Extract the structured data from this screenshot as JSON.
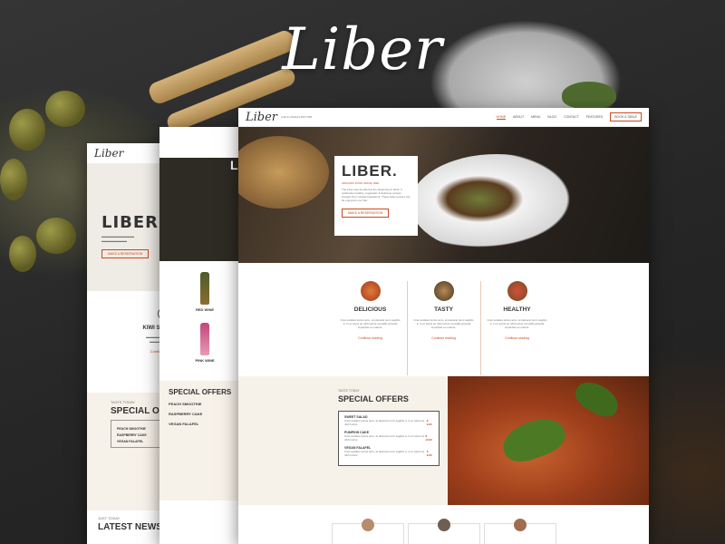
{
  "brand": {
    "logo": "Liber"
  },
  "back_screen": {
    "logo": "Liber",
    "hero_title": "LIBER.",
    "button": "MAKE A RESERVATION",
    "feature_title": "KIWI SMOOTHIE",
    "feature_link": "Continue reading",
    "offers_eyebrow": "TASTE TODAY",
    "offers_title": "SPECIAL OFFERS",
    "offers": [
      "PEACH SMOOTHIE",
      "RASPBERRY CAKE",
      "VEGAN FALAFEL"
    ],
    "news_eyebrow": "JUST TODAY",
    "news_title": "LATEST NEWS"
  },
  "mid_screen": {
    "hero_title": "LI",
    "products": [
      "RED WINE",
      "PINK WINE"
    ],
    "offers_title": "SPECIAL OFFERS",
    "offers": [
      "PEACH SMOOTHIE",
      "RASPBERRY CAKE",
      "VEGAN FALAFEL"
    ]
  },
  "front_screen": {
    "logo": "Liber",
    "contact": "Call Us (00)123 4567 890",
    "nav": [
      "HOME",
      "ABOUT",
      "MENU",
      "BLOG",
      "CONTACT",
      "FEATURES"
    ],
    "book_button": "BOOK A TABLE",
    "hero": {
      "title": "LIBER.",
      "subtitle": "ORGANIC FOOD SINCE 1996",
      "text": "The Liber was founded at the beginning of 2014. It celebrates healthy, vegetarian & delicious recipes created from natural ingredients. These tasty recipes can be enjoyed in our bar.",
      "button": "MAKE A RESERVATION"
    },
    "features": [
      {
        "title": "DELICIOUS",
        "text": "Cras sodales luctus arcu, at placerat nunc sagittis a. In et turpis ac nibh luctus convallis gravida imperdiet eu mauris.",
        "link": "Continue reading"
      },
      {
        "title": "TASTY",
        "text": "Cras sodales luctus arcu, at placerat nunc sagittis a. In et turpis ac nibh luctus convallis gravida imperdiet eu mauris.",
        "link": "Continue reading"
      },
      {
        "title": "HEALTHY",
        "text": "Cras sodales luctus arcu, at placerat nunc sagittis a. In et turpis ac nibh luctus convallis gravida imperdiet eu mauris.",
        "link": "Continue reading"
      }
    ],
    "special": {
      "eyebrow": "TASTE TODAY",
      "title": "SPECIAL OFFERS",
      "items": [
        {
          "name": "SWEET SALAD",
          "desc": "Cras sodales luctus arcu, at placerat nunc sagittis a. In et turpis ac nibh luctus",
          "price": "$ 9.90"
        },
        {
          "name": "PUMPKIN CAKE",
          "desc": "Cras sodales luctus arcu, at placerat nunc sagittis a. In et turpis ac nibh luctus",
          "price": "$ 12.90"
        },
        {
          "name": "VEGAN FALAFEL",
          "desc": "Cras sodales luctus arcu, at placerat nunc sagittis a. In et turpis ac nibh luctus",
          "price": "$ 9.90"
        }
      ]
    }
  },
  "colors": {
    "accent": "#c94a1e",
    "cream": "#f7f2e9"
  }
}
